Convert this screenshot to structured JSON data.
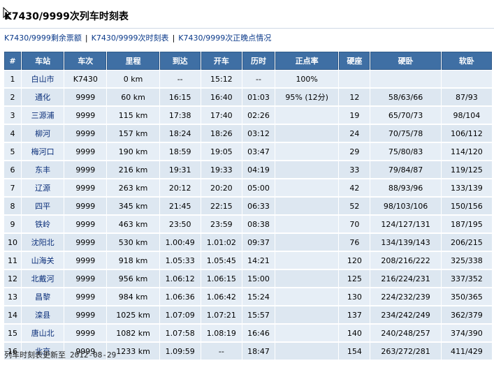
{
  "page": {
    "title": "K7430/9999次列车时刻表",
    "links": [
      "K7430/9999剩余票额",
      "K7430/9999次时刻表",
      "K7430/9999次正晚点情况"
    ],
    "link_separator": "|",
    "footer_label": "列车时刻表更新至",
    "footer_date": "2012-08-29"
  },
  "table": {
    "headers": [
      "#",
      "车站",
      "车次",
      "里程",
      "到达",
      "开车",
      "历时",
      "正点率",
      "硬座",
      "硬卧",
      "软卧"
    ],
    "rows": [
      [
        "1",
        "白山市",
        "K7430",
        "0 km",
        "--",
        "15:12",
        "--",
        "100%",
        "",
        "",
        ""
      ],
      [
        "2",
        "通化",
        "9999",
        "60 km",
        "16:15",
        "16:40",
        "01:03",
        "95% (12分)",
        "12",
        "58/63/66",
        "87/93"
      ],
      [
        "3",
        "三源浦",
        "9999",
        "115 km",
        "17:38",
        "17:40",
        "02:26",
        "",
        "19",
        "65/70/73",
        "98/104"
      ],
      [
        "4",
        "柳河",
        "9999",
        "157 km",
        "18:24",
        "18:26",
        "03:12",
        "",
        "24",
        "70/75/78",
        "106/112"
      ],
      [
        "5",
        "梅河口",
        "9999",
        "190 km",
        "18:59",
        "19:05",
        "03:47",
        "",
        "29",
        "75/80/83",
        "114/120"
      ],
      [
        "6",
        "东丰",
        "9999",
        "216 km",
        "19:31",
        "19:33",
        "04:19",
        "",
        "33",
        "79/84/87",
        "119/125"
      ],
      [
        "7",
        "辽源",
        "9999",
        "263 km",
        "20:12",
        "20:20",
        "05:00",
        "",
        "42",
        "88/93/96",
        "133/139"
      ],
      [
        "8",
        "四平",
        "9999",
        "345 km",
        "21:45",
        "22:15",
        "06:33",
        "",
        "52",
        "98/103/106",
        "150/156"
      ],
      [
        "9",
        "铁岭",
        "9999",
        "463 km",
        "23:50",
        "23:59",
        "08:38",
        "",
        "70",
        "124/127/131",
        "187/195"
      ],
      [
        "10",
        "沈阳北",
        "9999",
        "530 km",
        "1.00:49",
        "1.01:02",
        "09:37",
        "",
        "76",
        "134/139/143",
        "206/215"
      ],
      [
        "11",
        "山海关",
        "9999",
        "918 km",
        "1.05:33",
        "1.05:45",
        "14:21",
        "",
        "120",
        "208/216/222",
        "325/338"
      ],
      [
        "12",
        "北戴河",
        "9999",
        "956 km",
        "1.06:12",
        "1.06:15",
        "15:00",
        "",
        "125",
        "216/224/231",
        "337/352"
      ],
      [
        "13",
        "昌黎",
        "9999",
        "984 km",
        "1.06:36",
        "1.06:42",
        "15:24",
        "",
        "130",
        "224/232/239",
        "350/365"
      ],
      [
        "14",
        "滦县",
        "9999",
        "1025 km",
        "1.07:09",
        "1.07:21",
        "15:57",
        "",
        "137",
        "234/242/249",
        "362/379"
      ],
      [
        "15",
        "唐山北",
        "9999",
        "1082 km",
        "1.07:58",
        "1.08:19",
        "16:46",
        "",
        "140",
        "240/248/257",
        "374/390"
      ],
      [
        "16",
        "北京",
        "9999",
        "1233 km",
        "1.09:59",
        "--",
        "18:47",
        "",
        "154",
        "263/272/281",
        "411/429"
      ]
    ]
  }
}
